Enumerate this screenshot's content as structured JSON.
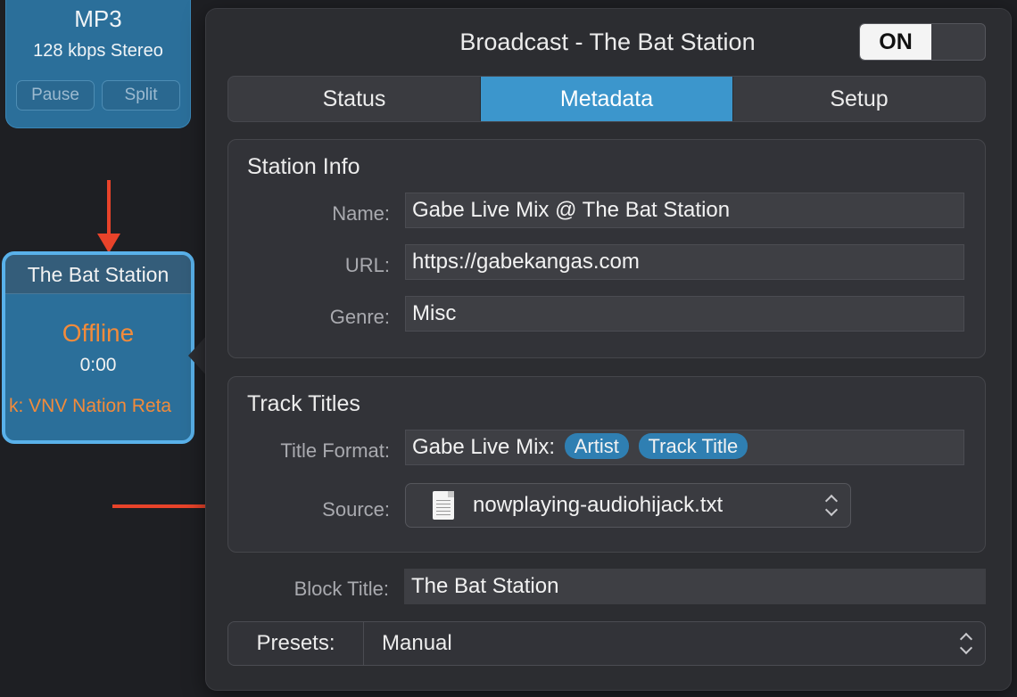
{
  "canvas": {
    "top_block": {
      "format": "MP3",
      "bitrate": "128 kbps Stereo",
      "pause_label": "Pause",
      "split_label": "Split"
    },
    "broadcast_block": {
      "name": "The Bat Station",
      "status": "Offline",
      "elapsed": "0:00",
      "track": "k: VNV Nation Reta"
    }
  },
  "popover": {
    "title": "Broadcast - The Bat Station",
    "toggle_label": "ON",
    "tabs": [
      {
        "label": "Status"
      },
      {
        "label": "Metadata"
      },
      {
        "label": "Setup"
      }
    ],
    "station_info": {
      "heading": "Station Info",
      "name_label": "Name:",
      "name_value": "Gabe Live Mix @ The Bat Station",
      "url_label": "URL:",
      "url_value": "https://gabekangas.com",
      "genre_label": "Genre:",
      "genre_value": "Misc"
    },
    "track_titles": {
      "heading": "Track Titles",
      "format_label": "Title Format:",
      "format_prefix": "Gabe Live Mix:",
      "tokens": [
        "Artist",
        "Track Title"
      ],
      "source_label": "Source:",
      "source_value": "nowplaying-audiohijack.txt"
    },
    "block_title_label": "Block Title:",
    "block_title_value": "The Bat Station",
    "presets_label": "Presets:",
    "presets_value": "Manual"
  },
  "colors": {
    "accent": "#3c96cc",
    "offline": "#f28b3b",
    "annotation_arrow": "#e8432a"
  }
}
